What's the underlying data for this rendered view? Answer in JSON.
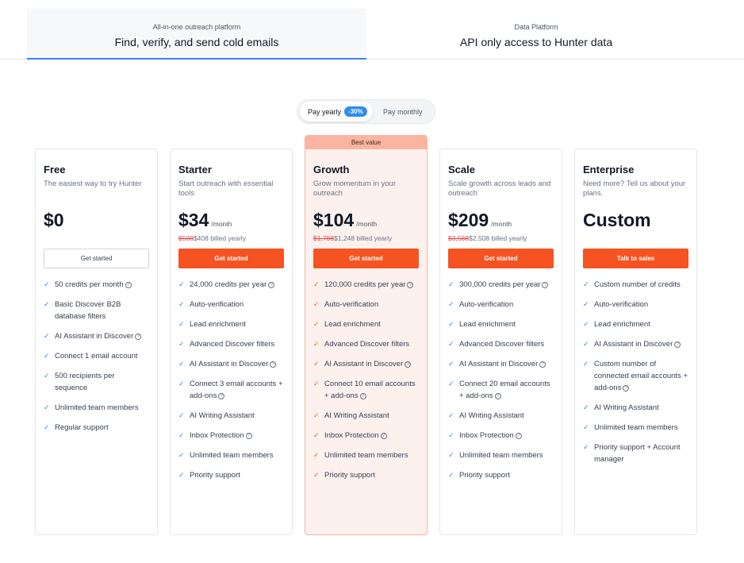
{
  "tabs": {
    "outreach": {
      "sub": "All-in-one outreach platform",
      "main": "Find, verify, and send cold emails"
    },
    "data": {
      "sub": "Data Platform",
      "main": "API only access to Hunter data"
    }
  },
  "billing_toggle": {
    "yearly": "Pay yearly",
    "discount": "-30%",
    "monthly": "Pay monthly"
  },
  "best_value": "Best value",
  "colors": {
    "accent": "#f55321",
    "tab_active": "#3b82f6",
    "badge": "#2b8cf2"
  },
  "plans": [
    {
      "name": "Free",
      "desc": "The easiest way to try Hunter",
      "price": "$0",
      "per": "",
      "old_price": "",
      "billed": "",
      "cta": "Get started",
      "cta_style": "outline",
      "highlight": false,
      "features": [
        {
          "text": "50 credits per month",
          "info": true
        },
        {
          "text": "Basic Discover B2B database filters",
          "info": false
        },
        {
          "text": "AI Assistant in Discover",
          "info": true
        },
        {
          "text": "Connect 1 email account",
          "info": false
        },
        {
          "text": "500 recipients per sequence",
          "info": false
        },
        {
          "text": "Unlimited team members",
          "info": false
        },
        {
          "text": "Regular support",
          "info": false
        }
      ]
    },
    {
      "name": "Starter",
      "desc": "Start outreach with essential tools",
      "price": "$34",
      "per": "/month",
      "old_price": "$588",
      "billed": "$408 billed yearly",
      "cta": "Get started",
      "cta_style": "solid",
      "highlight": false,
      "features": [
        {
          "text": "24,000 credits per year",
          "info": true
        },
        {
          "text": "Auto-verification",
          "info": false
        },
        {
          "text": "Lead enrichment",
          "info": false
        },
        {
          "text": "Advanced Discover filters",
          "info": false
        },
        {
          "text": "AI Assistant in Discover",
          "info": true
        },
        {
          "text": "Connect 3 email accounts + add-ons",
          "info": true
        },
        {
          "text": "AI Writing Assistant",
          "info": false
        },
        {
          "text": "Inbox Protection",
          "info": true
        },
        {
          "text": "Unlimited team members",
          "info": false
        },
        {
          "text": "Priority support",
          "info": false
        }
      ]
    },
    {
      "name": "Growth",
      "desc": "Grow momentum in your outreach",
      "price": "$104",
      "per": "/month",
      "old_price": "$1,788",
      "billed": "$1,248 billed yearly",
      "cta": "Get started",
      "cta_style": "solid",
      "highlight": true,
      "features": [
        {
          "text": "120,000 credits per year",
          "info": true
        },
        {
          "text": "Auto-verification",
          "info": false
        },
        {
          "text": "Lead enrichment",
          "info": false
        },
        {
          "text": "Advanced Discover filters",
          "info": false
        },
        {
          "text": "AI Assistant in Discover",
          "info": true
        },
        {
          "text": "Connect 10 email accounts + add-ons",
          "info": true
        },
        {
          "text": "AI Writing Assistant",
          "info": false
        },
        {
          "text": "Inbox Protection",
          "info": true
        },
        {
          "text": "Unlimited team members",
          "info": false
        },
        {
          "text": "Priority support",
          "info": false
        }
      ]
    },
    {
      "name": "Scale",
      "desc": "Scale growth across leads and outreach",
      "price": "$209",
      "per": "/month",
      "old_price": "$3,588",
      "billed": "$2,508 billed yearly",
      "cta": "Get started",
      "cta_style": "solid",
      "highlight": false,
      "features": [
        {
          "text": "300,000 credits per year",
          "info": true
        },
        {
          "text": "Auto-verification",
          "info": false
        },
        {
          "text": "Lead enrichment",
          "info": false
        },
        {
          "text": "Advanced Discover filters",
          "info": false
        },
        {
          "text": "AI Assistant in Discover",
          "info": true
        },
        {
          "text": "Connect 20 email accounts + add-ons",
          "info": true
        },
        {
          "text": "AI Writing Assistant",
          "info": false
        },
        {
          "text": "Inbox Protection",
          "info": true
        },
        {
          "text": "Unlimited team members",
          "info": false
        },
        {
          "text": "Priority support",
          "info": false
        }
      ]
    },
    {
      "name": "Enterprise",
      "desc": "Need more? Tell us about your plans.",
      "price": "Custom",
      "per": "",
      "old_price": "",
      "billed": "",
      "cta": "Talk to sales",
      "cta_style": "solid",
      "highlight": false,
      "features": [
        {
          "text": "Custom number of credits",
          "info": false
        },
        {
          "text": "Auto-verification",
          "info": false
        },
        {
          "text": "Lead enrichment",
          "info": false
        },
        {
          "text": "AI Assistant in Discover",
          "info": true
        },
        {
          "text": "Custom number of connected email accounts + add-ons",
          "info": true
        },
        {
          "text": "AI Writing Assistant",
          "info": false
        },
        {
          "text": "Unlimited team members",
          "info": false
        },
        {
          "text": "Priority support + Account manager",
          "info": false
        }
      ]
    }
  ]
}
